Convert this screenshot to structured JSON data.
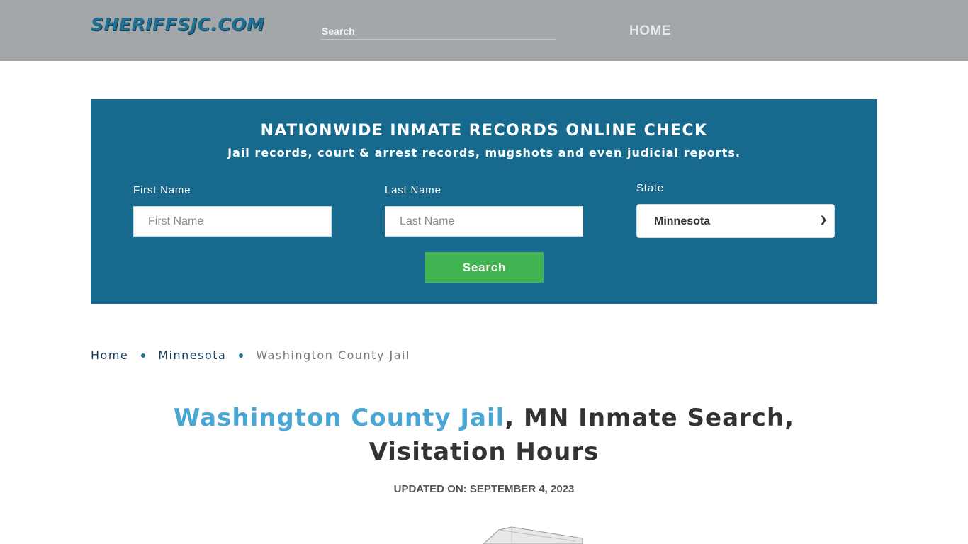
{
  "header": {
    "logo_text": "SHERIFFSJC.COM",
    "search_placeholder": "Search",
    "nav_home": "HOME"
  },
  "panel": {
    "title": "NATIONWIDE INMATE RECORDS ONLINE CHECK",
    "subtitle": "Jail records, court & arrest records, mugshots and even judicial reports.",
    "first_name_label": "First Name",
    "first_name_placeholder": "First Name",
    "last_name_label": "Last Name",
    "last_name_placeholder": "Last Name",
    "state_label": "State",
    "state_value": "Minnesota",
    "search_button": "Search"
  },
  "breadcrumb": {
    "home": "Home",
    "state": "Minnesota",
    "current": "Washington County Jail"
  },
  "main": {
    "title_highlight": "Washington County Jail",
    "title_rest": ", MN Inmate Search, Visitation Hours",
    "updated": "UPDATED ON: SEPTEMBER 4, 2023"
  },
  "colors": {
    "header_bg": "#a3a7aa",
    "panel_bg": "#176a8d",
    "button_bg": "#42b452",
    "title_highlight": "#4aa6d3"
  }
}
